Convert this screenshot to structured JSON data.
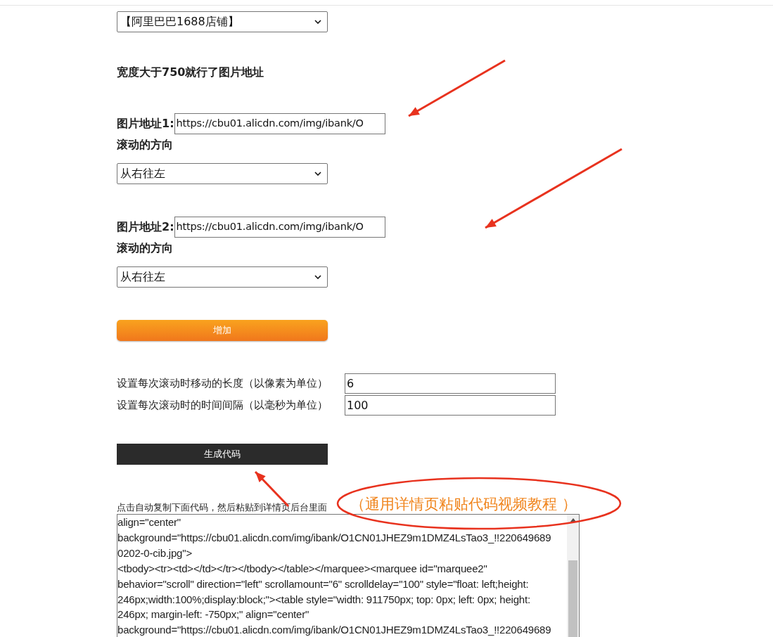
{
  "store_select": {
    "value": "【阿里巴巴1688店铺】"
  },
  "heading": "宽度大于750就行了图片地址",
  "images": [
    {
      "label": "图片地址1:",
      "url": "https://cbu01.alicdn.com/img/ibank/O",
      "direction_label": "滚动的方向",
      "direction": "从右往左"
    },
    {
      "label": "图片地址2:",
      "url": "https://cbu01.alicdn.com/img/ibank/O",
      "direction_label": "滚动的方向",
      "direction": "从右往左"
    }
  ],
  "add_button": "增加",
  "settings": [
    {
      "label": "设置每次滚动时移动的长度（以像素为单位）",
      "value": "6"
    },
    {
      "label": "设置每次滚动时的时间间隔（以毫秒为单位）",
      "value": "100"
    }
  ],
  "generate_button": "生成代码",
  "copy_hint": "点击自动复制下面代码，然后粘贴到详情页后台里面",
  "code_lines": [
    "align=\"center\"",
    "background=\"https://cbu01.alicdn.com/img/ibank/O1CN01JHEZ9m1DMZ4LsTao3_!!220649689",
    "0202-0-cib.jpg\">",
    "<tbody><tr><td></td></tr></tbody></table></marquee><marquee id=\"marquee2\"",
    "behavior=\"scroll\" direction=\"left\" scrollamount=\"6\" scrolldelay=\"100\" style=\"float: left;height:",
    "246px;width:100%;display:block;\"><table style=\"width: 911750px; top: 0px; left: 0px; height:",
    "246px; margin-left: -750px;\" align=\"center\"",
    "background=\"https://cbu01.alicdn.com/img/ibank/O1CN01JHEZ9m1DMZ4LsTao3_!!220649689"
  ],
  "annotation": {
    "text": "（通用详情页粘贴代码视频教程 ）"
  }
}
